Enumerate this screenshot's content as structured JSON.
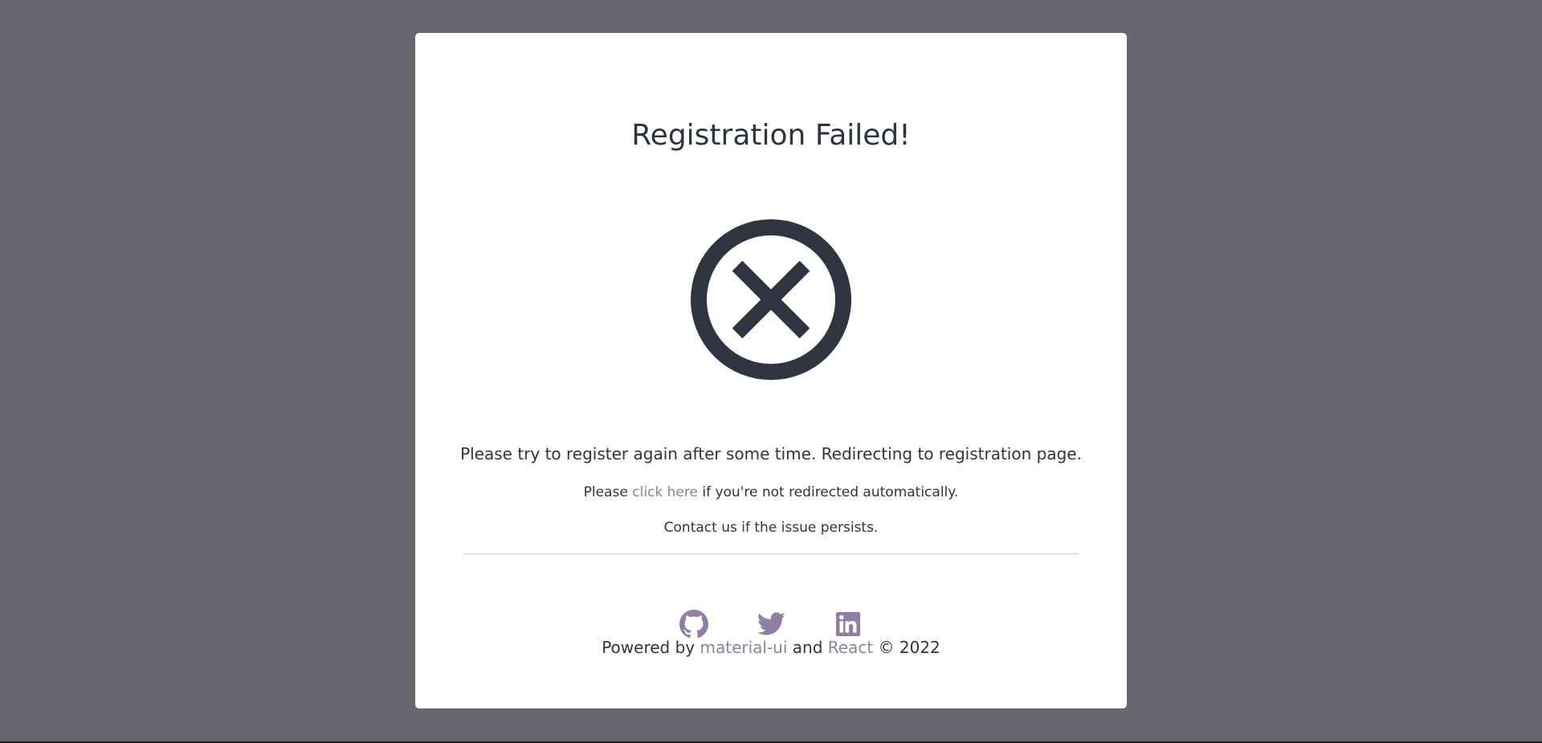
{
  "page": {
    "title": "Registration Failed!",
    "status_icon": "circle-x-icon"
  },
  "messages": {
    "main": "Please try to register again after some time. Redirecting to registration page.",
    "redirect_prefix": "Please ",
    "redirect_link": "click here",
    "redirect_suffix": " if you're not redirected automatically.",
    "contact": "Contact us if the issue persists."
  },
  "socials": [
    {
      "name": "GitHub",
      "icon": "github-icon"
    },
    {
      "name": "Twitter",
      "icon": "twitter-icon"
    },
    {
      "name": "LinkedIn",
      "icon": "linkedin-icon"
    }
  ],
  "footer": {
    "prefix": "Powered by ",
    "link1": "material-ui",
    "middle": " and ",
    "link2": "React",
    "suffix": " © 2022"
  },
  "colors": {
    "background": "#67656d",
    "card": "#ffffff",
    "text": "#2e3440",
    "accent": "#8f7fa3"
  }
}
